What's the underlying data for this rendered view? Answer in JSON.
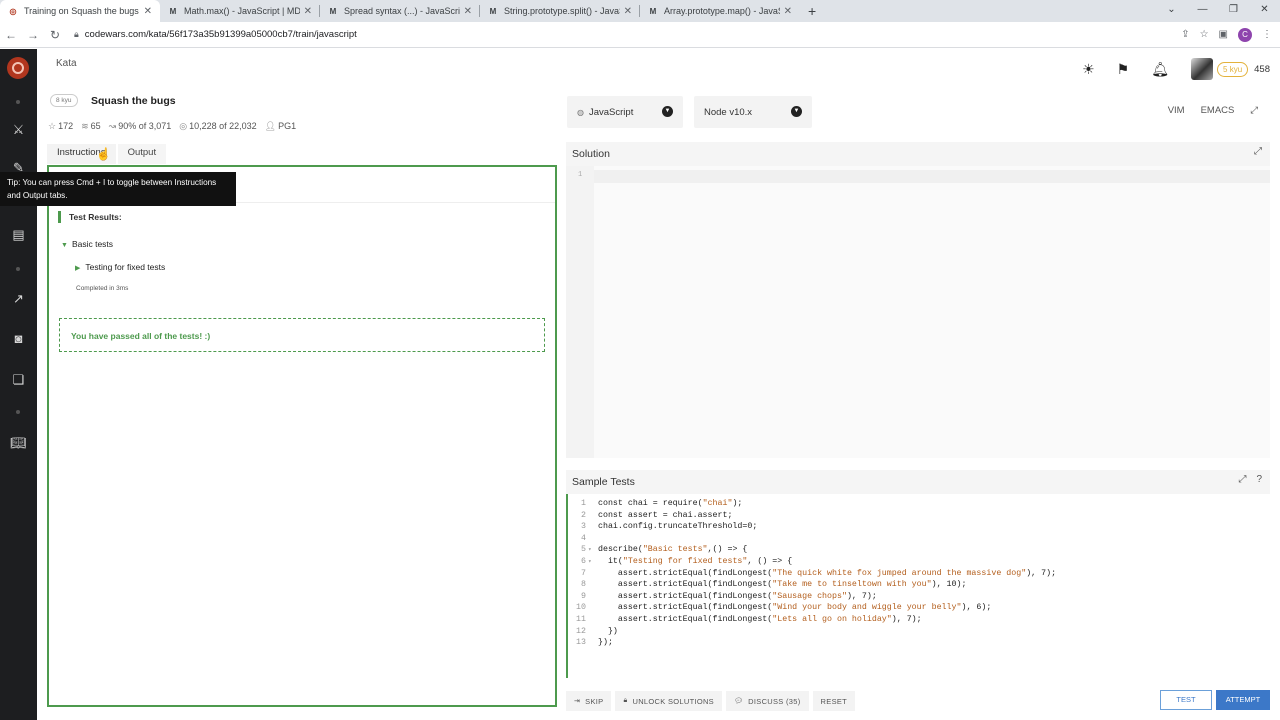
{
  "browser": {
    "tabs": [
      {
        "label": "Training on Squash the bugs | Codewars",
        "icon": "codewars-favicon",
        "active": true
      },
      {
        "label": "Math.max() - JavaScript | MDN",
        "icon": "mdn-favicon"
      },
      {
        "label": "Spread syntax (...) - JavaScript | MDN",
        "icon": "mdn-favicon"
      },
      {
        "label": "String.prototype.split() - JavaScript | MDN",
        "icon": "mdn-favicon"
      },
      {
        "label": "Array.prototype.map() - JavaScript | MDN",
        "icon": "mdn-favicon"
      }
    ],
    "new_tab": "+",
    "url": "codewars.com/kata/56f173a35b91399a05000cb7/train/javascript",
    "profile_initial": "C"
  },
  "header": {
    "kata_link": "Kata",
    "honor": "458",
    "rank": "5 kyu"
  },
  "kata": {
    "kyu": "8 kyu",
    "title": "Squash the bugs",
    "stats": {
      "stars": "172",
      "collections": "65",
      "satisfaction": "90% of 3,071",
      "completed": "10,228 of 22,032",
      "author": "PG1"
    }
  },
  "left_tabs": {
    "instructions": "Instructions",
    "output": "Output"
  },
  "tooltip": "Tip: You can press Cmd + I to toggle between Instructions and Output tabs.",
  "output": {
    "test_results": "Test Results:",
    "basic_tests": "Basic tests",
    "fixed_tests": "Testing for fixed tests",
    "completed": "Completed in 3ms",
    "passed": "You have passed all of the tests! :)"
  },
  "selects": {
    "language": "JavaScript",
    "node": "Node v10.x"
  },
  "editor_modes": {
    "vim": "VIM",
    "emacs": "EMACS"
  },
  "solution": {
    "title": "Solution",
    "line": "1"
  },
  "sample_tests": {
    "title": "Sample Tests",
    "lines": [
      {
        "n": "1",
        "fold": "",
        "code": "const chai = require(\"chai\");"
      },
      {
        "n": "2",
        "fold": "",
        "code": "const assert = chai.assert;"
      },
      {
        "n": "3",
        "fold": "",
        "code": "chai.config.truncateThreshold=0;"
      },
      {
        "n": "4",
        "fold": "",
        "code": ""
      },
      {
        "n": "5",
        "fold": "▾",
        "code": "describe(\"Basic tests\",() => {"
      },
      {
        "n": "6",
        "fold": "▾",
        "code": "  it(\"Testing for fixed tests\", () => {"
      },
      {
        "n": "7",
        "fold": "",
        "code": "    assert.strictEqual(findLongest(\"The quick white fox jumped around the massive dog\"), 7);"
      },
      {
        "n": "8",
        "fold": "",
        "code": "    assert.strictEqual(findLongest(\"Take me to tinseltown with you\"), 10);"
      },
      {
        "n": "9",
        "fold": "",
        "code": "    assert.strictEqual(findLongest(\"Sausage chops\"), 7);"
      },
      {
        "n": "10",
        "fold": "",
        "code": "    assert.strictEqual(findLongest(\"Wind your body and wiggle your belly\"), 6);"
      },
      {
        "n": "11",
        "fold": "",
        "code": "    assert.strictEqual(findLongest(\"Lets all go on holiday\"), 7);"
      },
      {
        "n": "12",
        "fold": "",
        "code": "  })"
      },
      {
        "n": "13",
        "fold": "",
        "code": "});"
      }
    ]
  },
  "bottom": {
    "skip": "SKIP",
    "unlock": "UNLOCK SOLUTIONS",
    "discuss": "DISCUSS (35)",
    "reset": "RESET",
    "test": "TEST",
    "attempt": "ATTEMPT"
  },
  "colors": {
    "accent_green": "#4d9a4d",
    "button_blue": "#3c78c8",
    "rail": "#1d1e20"
  }
}
